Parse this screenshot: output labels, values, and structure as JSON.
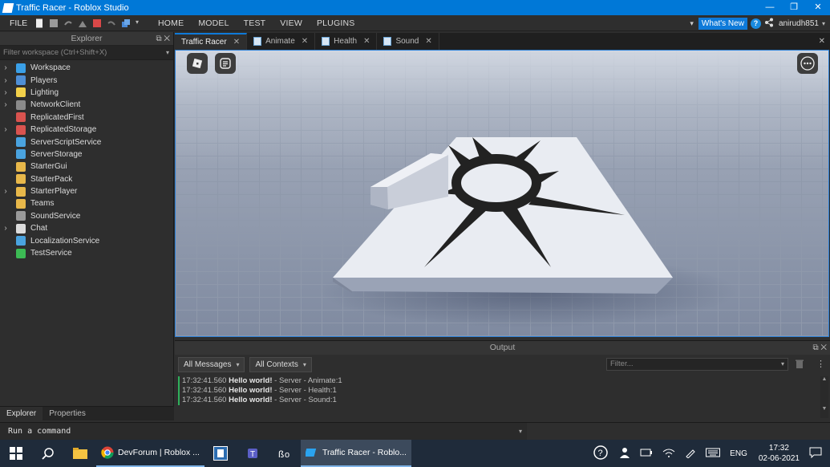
{
  "window": {
    "title": "Traffic Racer - Roblox Studio",
    "buttons": [
      "—",
      "❐",
      "✕"
    ]
  },
  "menu": {
    "file": "FILE",
    "tabs": [
      "HOME",
      "MODEL",
      "TEST",
      "VIEW",
      "PLUGINS"
    ],
    "whats_new": "What's New",
    "username": "anirudh851"
  },
  "explorer": {
    "title": "Explorer",
    "filter_placeholder": "Filter workspace (Ctrl+Shift+X)",
    "items": [
      {
        "label": "Workspace",
        "expandable": true,
        "icon": "workspace-icon",
        "color": "#3aa0e8"
      },
      {
        "label": "Players",
        "expandable": true,
        "icon": "players-icon",
        "color": "#4f8fd6"
      },
      {
        "label": "Lighting",
        "expandable": true,
        "icon": "lighting-icon",
        "color": "#f2d04a"
      },
      {
        "label": "NetworkClient",
        "expandable": true,
        "icon": "network-icon",
        "color": "#8a8a8a"
      },
      {
        "label": "ReplicatedFirst",
        "expandable": false,
        "icon": "replicated-first-icon",
        "color": "#d9534f"
      },
      {
        "label": "ReplicatedStorage",
        "expandable": true,
        "icon": "replicated-storage-icon",
        "color": "#d9534f"
      },
      {
        "label": "ServerScriptService",
        "expandable": false,
        "icon": "server-script-service-icon",
        "color": "#4aa3df"
      },
      {
        "label": "ServerStorage",
        "expandable": false,
        "icon": "server-storage-icon",
        "color": "#4aa3df"
      },
      {
        "label": "StarterGui",
        "expandable": false,
        "icon": "starter-gui-icon",
        "color": "#e8b84a"
      },
      {
        "label": "StarterPack",
        "expandable": false,
        "icon": "starter-pack-icon",
        "color": "#e8b84a"
      },
      {
        "label": "StarterPlayer",
        "expandable": true,
        "icon": "starter-player-icon",
        "color": "#e8b84a"
      },
      {
        "label": "Teams",
        "expandable": false,
        "icon": "teams-icon",
        "color": "#e8b84a"
      },
      {
        "label": "SoundService",
        "expandable": false,
        "icon": "sound-service-icon",
        "color": "#9a9a9a"
      },
      {
        "label": "Chat",
        "expandable": true,
        "icon": "chat-icon",
        "color": "#dcdcdc"
      },
      {
        "label": "LocalizationService",
        "expandable": false,
        "icon": "localization-service-icon",
        "color": "#4aa3df"
      },
      {
        "label": "TestService",
        "expandable": false,
        "icon": "test-service-icon",
        "color": "#3cba54"
      }
    ],
    "tabs": [
      "Explorer",
      "Properties"
    ]
  },
  "doc_tabs": [
    {
      "label": "Traffic Racer",
      "active": true,
      "script": false
    },
    {
      "label": "Animate",
      "active": false,
      "script": true
    },
    {
      "label": "Health",
      "active": false,
      "script": true
    },
    {
      "label": "Sound",
      "active": false,
      "script": true
    }
  ],
  "output": {
    "title": "Output",
    "message_filter": "All Messages",
    "context_filter": "All Contexts",
    "filter_placeholder": "Filter...",
    "lines": [
      {
        "time": "17:32:41.560",
        "message": "Hello world!",
        "source": "- Server - Animate:1"
      },
      {
        "time": "17:32:41.560",
        "message": "Hello world!",
        "source": "- Server - Health:1"
      },
      {
        "time": "17:32:41.560",
        "message": "Hello world!",
        "source": "- Server - Sound:1"
      }
    ]
  },
  "command_bar": {
    "placeholder": "Run a command"
  },
  "taskbar": {
    "apps": [
      {
        "label": "DevForum | Roblox ...",
        "icon": "chrome-icon",
        "state": "running"
      },
      {
        "label": "",
        "icon": "app-icon",
        "state": "none"
      },
      {
        "label": "",
        "icon": "teams-app-icon",
        "state": "none"
      },
      {
        "label": "",
        "icon": "bs-app-icon",
        "state": "none"
      },
      {
        "label": "Traffic Racer - Roblo...",
        "icon": "roblox-studio-icon",
        "state": "active"
      }
    ],
    "language": "ENG",
    "time": "17:32",
    "date": "02-06-2021"
  }
}
